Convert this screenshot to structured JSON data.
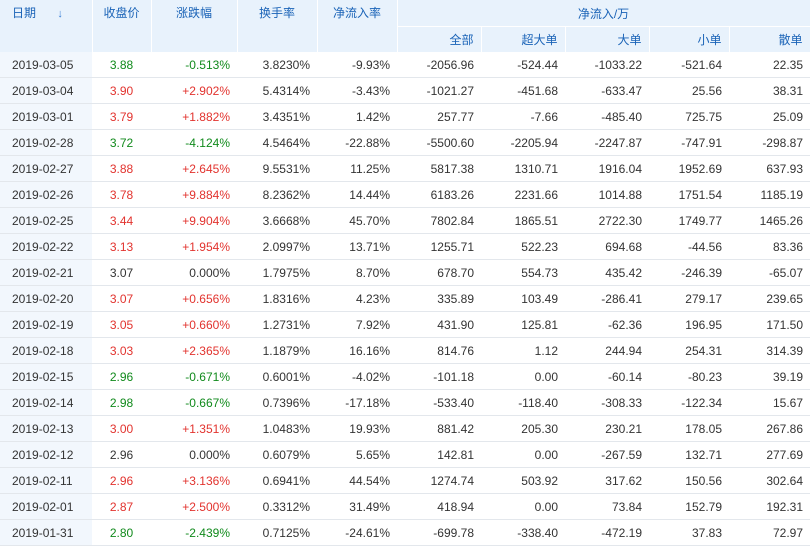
{
  "header": {
    "date": "日期",
    "sort_arrow": "↓",
    "close": "收盘价",
    "change": "涨跌幅",
    "turnover": "换手率",
    "net_ratio": "净流入率",
    "group": "净流入/万",
    "all": "全部",
    "super_large": "超大单",
    "large": "大单",
    "small": "小单",
    "retail": "散单"
  },
  "rows": [
    {
      "date": "2019-03-05",
      "close": "3.88",
      "change": "-0.513%",
      "turnover": "3.8230%",
      "net_ratio": "-9.93%",
      "all": "-2056.96",
      "super_large": "-524.44",
      "large": "-1033.22",
      "small": "-521.64",
      "retail": "22.35",
      "dir": "down"
    },
    {
      "date": "2019-03-04",
      "close": "3.90",
      "change": "+2.902%",
      "turnover": "5.4314%",
      "net_ratio": "-3.43%",
      "all": "-1021.27",
      "super_large": "-451.68",
      "large": "-633.47",
      "small": "25.56",
      "retail": "38.31",
      "dir": "up"
    },
    {
      "date": "2019-03-01",
      "close": "3.79",
      "change": "+1.882%",
      "turnover": "3.4351%",
      "net_ratio": "1.42%",
      "all": "257.77",
      "super_large": "-7.66",
      "large": "-485.40",
      "small": "725.75",
      "retail": "25.09",
      "dir": "up"
    },
    {
      "date": "2019-02-28",
      "close": "3.72",
      "change": "-4.124%",
      "turnover": "4.5464%",
      "net_ratio": "-22.88%",
      "all": "-5500.60",
      "super_large": "-2205.94",
      "large": "-2247.87",
      "small": "-747.91",
      "retail": "-298.87",
      "dir": "down"
    },
    {
      "date": "2019-02-27",
      "close": "3.88",
      "change": "+2.645%",
      "turnover": "9.5531%",
      "net_ratio": "11.25%",
      "all": "5817.38",
      "super_large": "1310.71",
      "large": "1916.04",
      "small": "1952.69",
      "retail": "637.93",
      "dir": "up"
    },
    {
      "date": "2019-02-26",
      "close": "3.78",
      "change": "+9.884%",
      "turnover": "8.2362%",
      "net_ratio": "14.44%",
      "all": "6183.26",
      "super_large": "2231.66",
      "large": "1014.88",
      "small": "1751.54",
      "retail": "1185.19",
      "dir": "up"
    },
    {
      "date": "2019-02-25",
      "close": "3.44",
      "change": "+9.904%",
      "turnover": "3.6668%",
      "net_ratio": "45.70%",
      "all": "7802.84",
      "super_large": "1865.51",
      "large": "2722.30",
      "small": "1749.77",
      "retail": "1465.26",
      "dir": "up"
    },
    {
      "date": "2019-02-22",
      "close": "3.13",
      "change": "+1.954%",
      "turnover": "2.0997%",
      "net_ratio": "13.71%",
      "all": "1255.71",
      "super_large": "522.23",
      "large": "694.68",
      "small": "-44.56",
      "retail": "83.36",
      "dir": "up"
    },
    {
      "date": "2019-02-21",
      "close": "3.07",
      "change": "0.000%",
      "turnover": "1.7975%",
      "net_ratio": "8.70%",
      "all": "678.70",
      "super_large": "554.73",
      "large": "435.42",
      "small": "-246.39",
      "retail": "-65.07",
      "dir": "flat"
    },
    {
      "date": "2019-02-20",
      "close": "3.07",
      "change": "+0.656%",
      "turnover": "1.8316%",
      "net_ratio": "4.23%",
      "all": "335.89",
      "super_large": "103.49",
      "large": "-286.41",
      "small": "279.17",
      "retail": "239.65",
      "dir": "up"
    },
    {
      "date": "2019-02-19",
      "close": "3.05",
      "change": "+0.660%",
      "turnover": "1.2731%",
      "net_ratio": "7.92%",
      "all": "431.90",
      "super_large": "125.81",
      "large": "-62.36",
      "small": "196.95",
      "retail": "171.50",
      "dir": "up"
    },
    {
      "date": "2019-02-18",
      "close": "3.03",
      "change": "+2.365%",
      "turnover": "1.1879%",
      "net_ratio": "16.16%",
      "all": "814.76",
      "super_large": "1.12",
      "large": "244.94",
      "small": "254.31",
      "retail": "314.39",
      "dir": "up"
    },
    {
      "date": "2019-02-15",
      "close": "2.96",
      "change": "-0.671%",
      "turnover": "0.6001%",
      "net_ratio": "-4.02%",
      "all": "-101.18",
      "super_large": "0.00",
      "large": "-60.14",
      "small": "-80.23",
      "retail": "39.19",
      "dir": "down"
    },
    {
      "date": "2019-02-14",
      "close": "2.98",
      "change": "-0.667%",
      "turnover": "0.7396%",
      "net_ratio": "-17.18%",
      "all": "-533.40",
      "super_large": "-118.40",
      "large": "-308.33",
      "small": "-122.34",
      "retail": "15.67",
      "dir": "down"
    },
    {
      "date": "2019-02-13",
      "close": "3.00",
      "change": "+1.351%",
      "turnover": "1.0483%",
      "net_ratio": "19.93%",
      "all": "881.42",
      "super_large": "205.30",
      "large": "230.21",
      "small": "178.05",
      "retail": "267.86",
      "dir": "up"
    },
    {
      "date": "2019-02-12",
      "close": "2.96",
      "change": "0.000%",
      "turnover": "0.6079%",
      "net_ratio": "5.65%",
      "all": "142.81",
      "super_large": "0.00",
      "large": "-267.59",
      "small": "132.71",
      "retail": "277.69",
      "dir": "flat"
    },
    {
      "date": "2019-02-11",
      "close": "2.96",
      "change": "+3.136%",
      "turnover": "0.6941%",
      "net_ratio": "44.54%",
      "all": "1274.74",
      "super_large": "503.92",
      "large": "317.62",
      "small": "150.56",
      "retail": "302.64",
      "dir": "up"
    },
    {
      "date": "2019-02-01",
      "close": "2.87",
      "change": "+2.500%",
      "turnover": "0.3312%",
      "net_ratio": "31.49%",
      "all": "418.94",
      "super_large": "0.00",
      "large": "73.84",
      "small": "152.79",
      "retail": "192.31",
      "dir": "up"
    },
    {
      "date": "2019-01-31",
      "close": "2.80",
      "change": "-2.439%",
      "turnover": "0.7125%",
      "net_ratio": "-24.61%",
      "all": "-699.78",
      "super_large": "-338.40",
      "large": "-472.19",
      "small": "37.83",
      "retail": "72.97",
      "dir": "down"
    }
  ],
  "colors": {
    "up": "#e2332e",
    "down": "#118a1c",
    "header_text": "#1a63b7",
    "header_bg": "#e8f2fc"
  }
}
